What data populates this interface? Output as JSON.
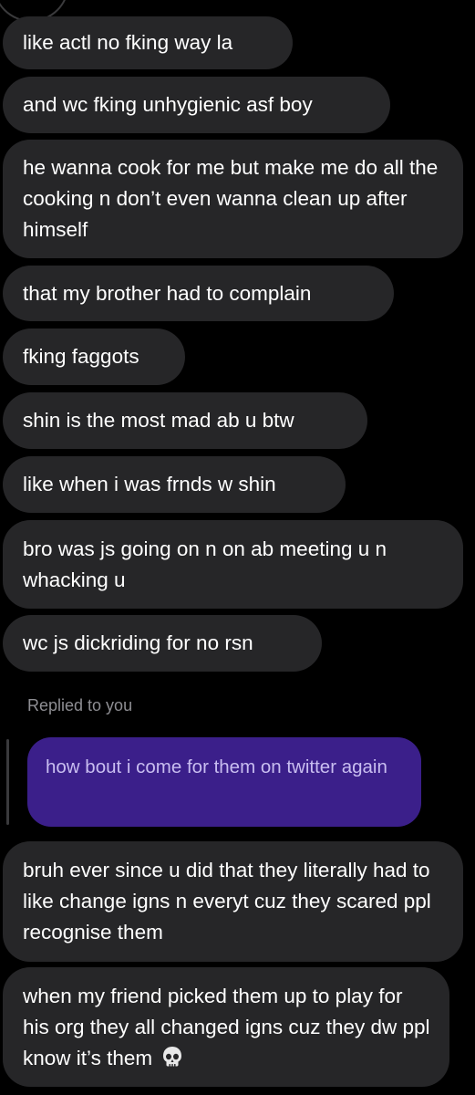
{
  "messages": [
    {
      "text": "like actl no fking way la"
    },
    {
      "text": "and wc fking unhygienic asf boy"
    },
    {
      "text": "he wanna cook for me but make me do all the cooking n don’t even wanna clean up after himself"
    },
    {
      "text": "that my brother had to complain"
    },
    {
      "text": "fking faggots"
    },
    {
      "text": "shin is the most mad ab u btw"
    },
    {
      "text": "like when i was frnds w shin"
    },
    {
      "text": "bro was js going on n on ab meeting u n whacking u"
    },
    {
      "text": "wc js dickriding for no rsn"
    }
  ],
  "reply": {
    "label": "Replied to you",
    "quoted_text": "how bout i come for them on twitter again"
  },
  "after_reply": [
    {
      "text": "bruh ever since u did that they literally had to like change igns n everyt cuz they scared ppl recognise them"
    },
    {
      "text": "when my friend picked them up to play for his org they all changed igns cuz they dw ppl know it’s them",
      "emoji": "skull-icon"
    }
  ],
  "colors": {
    "background": "#000000",
    "incoming_bubble": "#262628",
    "quoted_bubble": "#3b1f8a",
    "quoted_text": "#c8bdf0",
    "meta_text": "#8e8e93"
  }
}
